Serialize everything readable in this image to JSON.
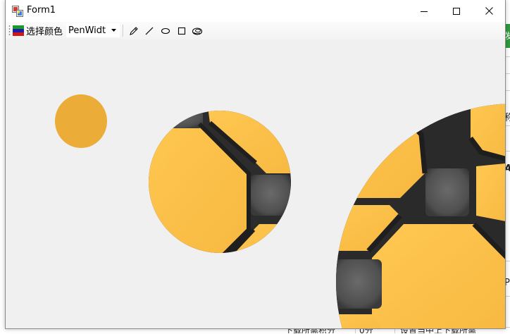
{
  "window": {
    "title": "Form1",
    "controls": [
      "minimize-icon",
      "maximize-icon",
      "close-icon"
    ]
  },
  "toolbar": {
    "color_button_label": "选择颜色",
    "pen_width_label": "PenWidth",
    "tools": [
      "pencil-icon",
      "line-icon",
      "ellipse-icon",
      "rectangle-icon",
      "eraser-icon"
    ]
  },
  "colors": {
    "window_bg": "#f0f0f0",
    "honey_dark": "#e8aa33",
    "honey": "#fbbf45",
    "tile_gray": "#525252",
    "groove": "#2a2a2a",
    "swatch": [
      "#1a9a2a",
      "#1e1ea8",
      "#d01818"
    ]
  },
  "background_app": {
    "green_button_text": "发",
    "fragments": [
      "称",
      "A",
      "P"
    ],
    "bottom_texts": [
      "下载所需积分",
      "0分",
      "设置当中上下载所需"
    ]
  }
}
